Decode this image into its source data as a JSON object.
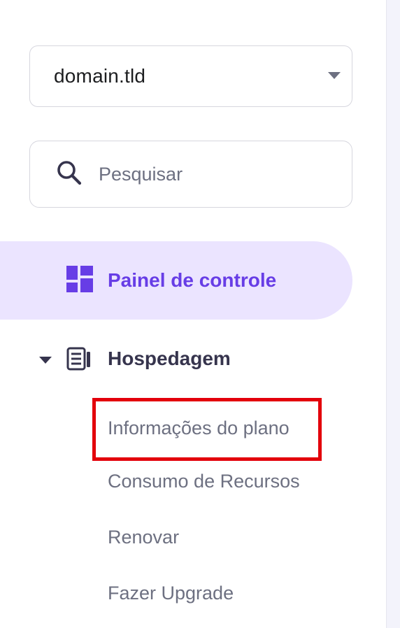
{
  "domain_select": {
    "value": "domain.tld"
  },
  "search": {
    "placeholder": "Pesquisar"
  },
  "nav": {
    "dashboard": {
      "label": "Painel de controle",
      "icon": "dashboard-icon",
      "active": true
    },
    "hosting": {
      "label": "Hospedagem",
      "icon": "server-icon",
      "expanded": true,
      "items": [
        {
          "label": "Informações do plano",
          "highlighted": true
        },
        {
          "label": "Consumo de Recursos"
        },
        {
          "label": "Renovar"
        },
        {
          "label": "Fazer Upgrade"
        }
      ]
    }
  },
  "colors": {
    "accent": "#673de6",
    "active_bg": "#ebe4ff",
    "text_primary": "#1d1e20",
    "text_secondary": "#6d7081",
    "group_text": "#36344d",
    "highlight_border": "#e3000b",
    "input_border": "#d6d6de"
  }
}
